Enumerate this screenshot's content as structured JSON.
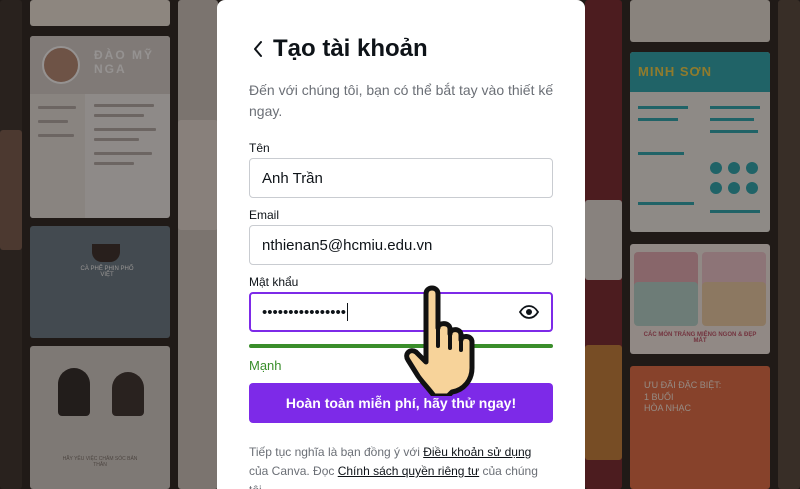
{
  "background": {
    "cv_name": "ĐÀO MỸ NGA",
    "cafe_title": "CÀ PHÊ PHIN PHỐ VIỆT",
    "friends_caption": "HÃY YÊU VIỆC CHĂM SÓC BẢN THÂN",
    "resume_name": "MINH SƠN",
    "food_caption": "CÁC MÓN TRÁNG MIỆNG NGON & ĐẸP MẮT",
    "music_line1": "ƯU ĐÃI ĐẶC BIỆT:",
    "music_line2": "1 BUỔI",
    "music_line3": "HÒA NHẠC"
  },
  "modal": {
    "back_icon": "chevron-left-icon",
    "title": "Tạo tài khoản",
    "subtitle": "Đến với chúng tôi, bạn có thể bắt tay vào thiết kế ngay.",
    "name_label": "Tên",
    "name_value": "Anh Trần",
    "email_label": "Email",
    "email_value": "nthienan5@hcmiu.edu.vn",
    "password_label": "Mật khẩu",
    "password_masked": "••••••••••••••••",
    "password_strength": "Mạnh",
    "submit_label": "Hoàn toàn miễn phí, hãy thử ngay!",
    "terms_prefix": "Tiếp tục nghĩa là bạn đồng ý với ",
    "terms_link": "Điều khoản sử dụng",
    "terms_middle": " của Canva. Đọc ",
    "privacy_link": "Chính sách quyền riêng tư",
    "terms_suffix": " của chúng tôi."
  },
  "colors": {
    "accent": "#7d2ae8",
    "strength_strong": "#3a8e2b",
    "focus_border": "#7d2ae8"
  },
  "cursor": "pointing-hand-icon"
}
